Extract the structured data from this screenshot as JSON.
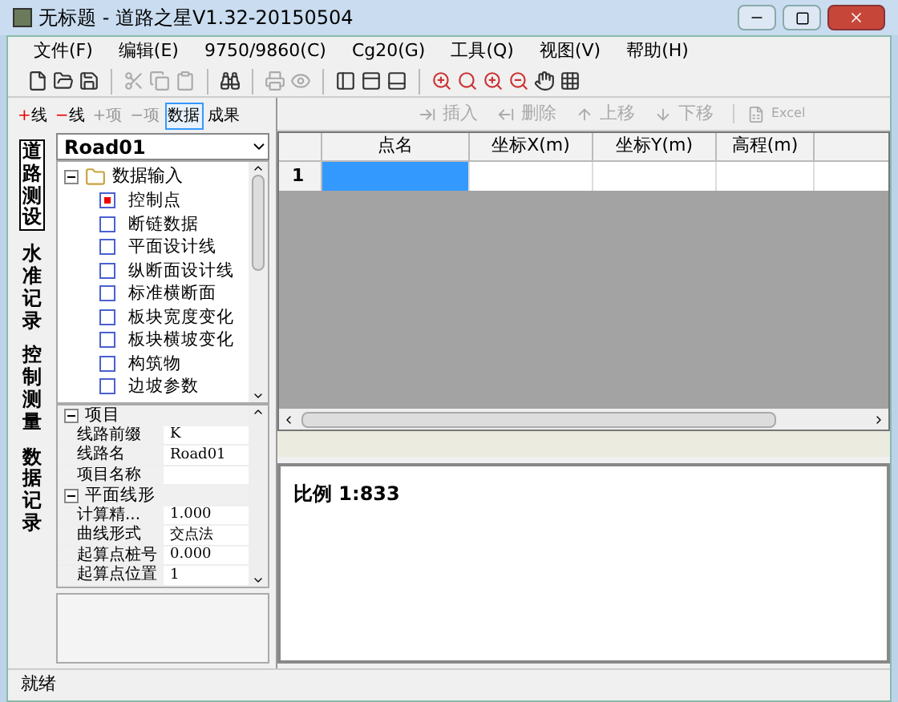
{
  "window": {
    "title": "无标题 - 道路之星V1.32-20150504"
  },
  "menu": [
    "文件(F)",
    "编辑(E)",
    "9750/9860(C)",
    "Cg20(G)",
    "工具(Q)",
    "视图(V)",
    "帮助(H)"
  ],
  "side_tabs": [
    {
      "label": "道路测设",
      "selected": true
    },
    {
      "label": "水准记录",
      "selected": false
    },
    {
      "label": "控制测量",
      "selected": false
    },
    {
      "label": "数据记录",
      "selected": false
    }
  ],
  "left_toolbar": [
    {
      "label": "+线",
      "kind": "add",
      "selected": false
    },
    {
      "label": "−线",
      "kind": "remove",
      "selected": false
    },
    {
      "label": "+项",
      "kind": "disabled",
      "selected": false
    },
    {
      "label": "−项",
      "kind": "disabled",
      "selected": false
    },
    {
      "label": "数据",
      "kind": "tab",
      "selected": true
    },
    {
      "label": "成果",
      "kind": "tab",
      "selected": false
    }
  ],
  "road_select": {
    "value": "Road01"
  },
  "tree": {
    "label": "数据输入",
    "expanded": true,
    "children": [
      {
        "label": "控制点",
        "selected": true
      },
      {
        "label": "断链数据",
        "selected": false
      },
      {
        "label": "平面设计线",
        "selected": false
      },
      {
        "label": "纵断面设计线",
        "selected": false
      },
      {
        "label": "标准横断面",
        "selected": false
      },
      {
        "label": "板块宽度变化",
        "selected": false
      },
      {
        "label": "板块横坡变化",
        "selected": false
      },
      {
        "label": "构筑物",
        "selected": false
      },
      {
        "label": "边坡参数",
        "selected": false
      }
    ]
  },
  "properties": [
    {
      "category": "项目",
      "expanded": true,
      "rows": [
        {
          "name": "线路前缀",
          "value": "K"
        },
        {
          "name": "线路名",
          "value": "Road01"
        },
        {
          "name": "项目名称"
        }
      ]
    },
    {
      "category": "平面线形",
      "expanded": true,
      "rows": [
        {
          "name": "计算精...",
          "value": "1.000"
        },
        {
          "name": "曲线形式",
          "value": "交点法"
        },
        {
          "name": "起算点桩号",
          "value": "0.000"
        },
        {
          "name": "起算点位置",
          "value": "1"
        }
      ]
    }
  ],
  "grid_toolbar": [
    {
      "label": "插入",
      "kind": "insert"
    },
    {
      "label": "删除",
      "kind": "delete"
    },
    {
      "label": "上移",
      "kind": "up"
    },
    {
      "label": "下移",
      "kind": "down"
    },
    {
      "label": "Excel",
      "kind": "excel"
    }
  ],
  "table": {
    "columns": [
      "点名",
      "坐标X(m)",
      "坐标Y(m)",
      "高程(m)"
    ],
    "rows": [
      {
        "number": "1",
        "selected": true
      }
    ]
  },
  "drawing": {
    "scale": "比例 1:833"
  },
  "status_bar": "就绪"
}
